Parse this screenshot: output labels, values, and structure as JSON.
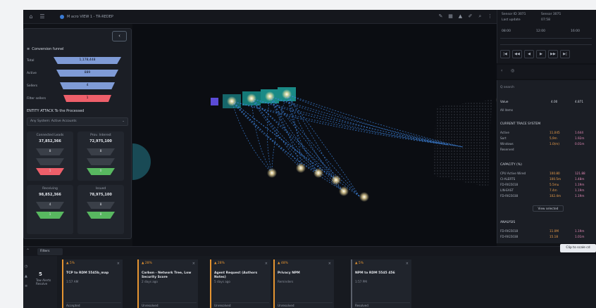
{
  "topbar": {
    "breadcrumb": "M acro VIEW 1 - TR-REDEP",
    "icons_left": [
      "home-icon",
      "menu-icon"
    ],
    "icons_right": [
      "edit-icon",
      "grid-icon",
      "warning-icon",
      "pencil-icon",
      "search-icon",
      "more-icon"
    ]
  },
  "left_panel": {
    "toggle_label": "‹",
    "title": "Conversion funnel",
    "funnel": [
      {
        "label": "Total",
        "value": "1,178,448",
        "color": "#7f9bd6"
      },
      {
        "label": "Active",
        "value": "889",
        "color": "#7f9bd6"
      },
      {
        "label": "Sellers",
        "value": "4",
        "color": "#7f9bd6"
      },
      {
        "label": "Filter sellers",
        "value": "1",
        "color": "#ee5f6a"
      }
    ],
    "section_title": "ENTITY ATTACK To the Processed",
    "filter_value": "Any System: Active Accounts",
    "cards": [
      {
        "title": "Connected Leads",
        "value": "37,852,366",
        "trap": [
          "8",
          "1"
        ],
        "trap_colors": [
          "#3a3f48",
          "#ee5f6a"
        ]
      },
      {
        "title": "Prov. Interest",
        "value": "72,975,100",
        "trap": [
          "8",
          "0"
        ],
        "trap_colors": [
          "#3a3f48",
          "#58b860"
        ]
      },
      {
        "title": "Receiving",
        "value": "98,852,366",
        "trap": [
          "4",
          "1"
        ],
        "trap_colors": [
          "#3a3f48",
          "#58b860"
        ]
      },
      {
        "title": "Issued",
        "value": "78,975,100",
        "trap": [
          "8",
          "8"
        ],
        "trap_colors": [
          "#3a3f48",
          "#58b860"
        ]
      }
    ]
  },
  "right_panel": {
    "top": {
      "label1": "Sensor ID 3071",
      "label2": "Sensor 3071",
      "label3": "Last update",
      "label4": "07:58",
      "t1": "08:00",
      "t2": "12:00",
      "t3": "16:00",
      "play_buttons": [
        "|◀",
        "◀◀",
        "◀",
        "▶",
        "▶▶",
        "▶|"
      ]
    },
    "search_label": "Q search",
    "header": {
      "label": "Value",
      "c1": "4.00",
      "c2": "4.871"
    },
    "subheader": "All items",
    "sec1_title": "CURRENT TRACE SYSTEM",
    "sec1_rows": [
      {
        "name": "Active",
        "a": "11,045",
        "b": "1.644"
      },
      {
        "name": "Sort",
        "a": "5,9m",
        "b": "1.92m"
      },
      {
        "name": "Windows",
        "a": "1.0(m)",
        "b": "0.01m"
      },
      {
        "name": "Reserved",
        "a": "",
        "b": ""
      }
    ],
    "sec2_title": "CAPACITY (%)",
    "sec2_rows": [
      {
        "name": "CPU Active Wired",
        "a": "100.80",
        "b": "121.88"
      },
      {
        "name": "CI-ALERTS",
        "a": "100.5m",
        "b": "1.48m"
      },
      {
        "name": "FD-RIG5018",
        "a": "5.5mu",
        "b": "1.19m"
      },
      {
        "name": "LIN-EAST",
        "a": "7.4m",
        "b": "1.19m"
      },
      {
        "name": "FD-RIG5038",
        "a": "102.4m",
        "b": "1.19m"
      }
    ],
    "view_all": "View selected",
    "sec3_title": "ANALYSIS",
    "sec3_rows": [
      {
        "name": "FD-RIG5018",
        "a": "11.0M",
        "b": "1.19m"
      },
      {
        "name": "FD-RIG5038",
        "a": "15.18",
        "b": "1.01m"
      }
    ]
  },
  "connect_button": "Clip to scale cd",
  "bottom_tab": "Filters",
  "tray": {
    "left_count": "5",
    "left_label": "Tow Alerts Resolve",
    "alerts": [
      {
        "badge": "▲ 5%",
        "title": "TCP to RDM 5545b_map",
        "sub": "1:57 AM",
        "footer": "Accepted",
        "muted": false
      },
      {
        "badge": "▲ 28%",
        "title": "Carbon - Network Tree, Low Security Score",
        "sub": "2 days ago",
        "footer": "Unresolved",
        "muted": false
      },
      {
        "badge": "▲ 28%",
        "title": "Agent Request (Authors Notes)",
        "sub": "5 days ago",
        "footer": "Unresolved",
        "muted": false
      },
      {
        "badge": "▲ 48%",
        "title": "Privacy NPM",
        "sub": "Reminders",
        "footer": "Unresolved",
        "muted": false
      },
      {
        "badge": "▲ 5%",
        "title": "NPM to RDM 5545 456",
        "sub": "1:57 PM",
        "footer": "Resolved",
        "muted": true
      }
    ]
  }
}
